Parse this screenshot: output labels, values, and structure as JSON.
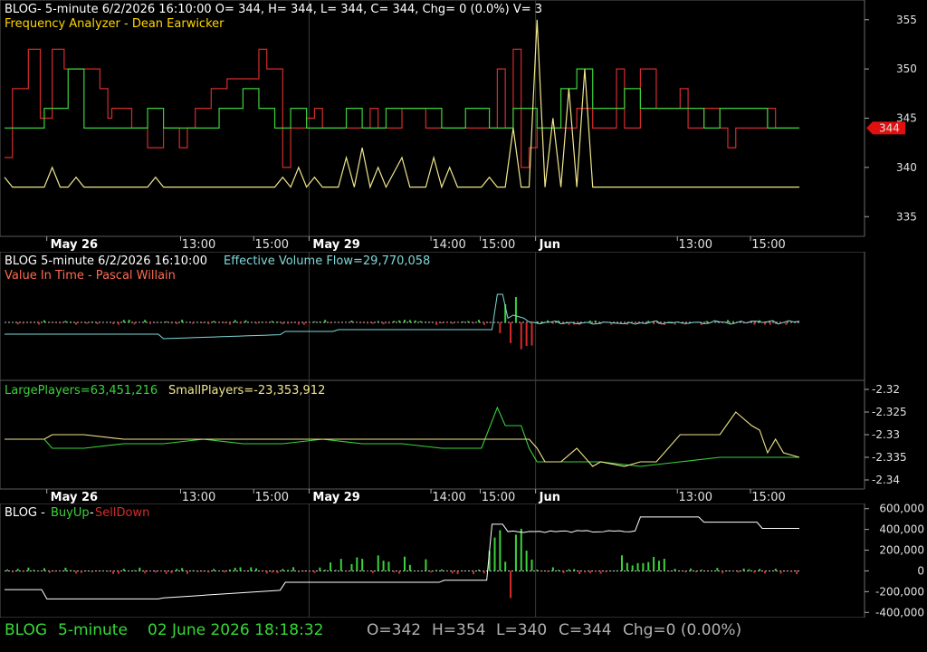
{
  "colors": {
    "red": "#d42c2c",
    "green": "#3bd23b",
    "yellow": "#f0e68c",
    "cyan": "#7fd8d8",
    "orange_text": "#ff5a3c",
    "salmon_text": "#ff6b50",
    "white": "#ffffff",
    "grid": "#3a3a3a",
    "status_green": "#35d935",
    "status_gray": "#b0b0b0"
  },
  "panel1": {
    "header_line1": "BLOG- 5-minute 6/2/2026 16:10:00 O= 344, H= 344, L= 344, C= 344, Chg= 0 (0.0%) V= 3",
    "header_line2": "Frequency Analyzer - Dean Earwicker",
    "price_marker": "344"
  },
  "panel2": {
    "header_a": "BLOG 5-minute  6/2/2026 16:10:00",
    "header_b": "Effective Volume Flow=29,770,058",
    "header_line2": "Value In Time - Pascal Willain"
  },
  "panel3": {
    "header_a": "LargePlayers=63,451,216",
    "header_b": "SmallPlayers=-23,353,912"
  },
  "panel4": {
    "header_a": "BLOG - ",
    "header_b": "BuyUp",
    "header_c": "-",
    "header_d": "SellDown"
  },
  "status": {
    "symbol": "BLOG",
    "interval": "5-minute",
    "datetime": "02 June 2026 18:18:32",
    "open": "O=342",
    "high": "H=354",
    "low": "L=340",
    "close": "C=344",
    "chg": "Chg=0 (0.00%)"
  },
  "x_labels": {
    "dates": [
      {
        "label": "May 26",
        "x": 0.06
      },
      {
        "label": "May 29",
        "x": 0.39
      },
      {
        "label": "Jun",
        "x": 0.675
      }
    ],
    "times": [
      {
        "label": "13:00",
        "x": 0.25
      },
      {
        "label": "15:00",
        "x": 0.342
      },
      {
        "label": "14:00",
        "x": 0.565
      },
      {
        "label": "15:00",
        "x": 0.627
      },
      {
        "label": "13:00",
        "x": 0.875
      },
      {
        "label": "15:00",
        "x": 0.967
      }
    ]
  },
  "chart_data": [
    {
      "type": "line",
      "panel": "price",
      "ylim": [
        333,
        357
      ],
      "yticks": [
        335,
        340,
        345,
        350,
        355
      ],
      "series": [
        {
          "name": "Frequency Analyzer",
          "color": "#d42c2c",
          "style": "step",
          "x": [
            0,
            0.01,
            0.02,
            0.03,
            0.04,
            0.045,
            0.06,
            0.075,
            0.085,
            0.1,
            0.12,
            0.13,
            0.135,
            0.14,
            0.16,
            0.18,
            0.19,
            0.2,
            0.21,
            0.22,
            0.23,
            0.24,
            0.25,
            0.26,
            0.28,
            0.3,
            0.32,
            0.33,
            0.34,
            0.35,
            0.36,
            0.38,
            0.39,
            0.4,
            0.42,
            0.44,
            0.46,
            0.47,
            0.49,
            0.5,
            0.52,
            0.53,
            0.55,
            0.57,
            0.6,
            0.62,
            0.63,
            0.64,
            0.65,
            0.66,
            0.67,
            0.68,
            0.7,
            0.72,
            0.74,
            0.75,
            0.77,
            0.78,
            0.79,
            0.8,
            0.82,
            0.84,
            0.85,
            0.86,
            0.88,
            0.9,
            0.91,
            0.92,
            0.94,
            0.96,
            0.97,
            0.98,
            1.0
          ],
          "values": [
            341,
            348,
            348,
            352,
            352,
            345,
            352,
            350,
            350,
            350,
            348,
            345,
            346,
            346,
            344,
            342,
            342,
            344,
            344,
            342,
            344,
            346,
            346,
            348,
            349,
            349,
            352,
            350,
            350,
            340,
            344,
            345,
            346,
            344,
            344,
            344,
            346,
            344,
            344,
            346,
            346,
            344,
            344,
            344,
            344,
            350,
            344,
            352,
            340,
            342,
            344,
            344,
            344,
            346,
            344,
            344,
            350,
            344,
            344,
            350,
            346,
            346,
            348,
            344,
            346,
            344,
            342,
            344,
            344,
            346,
            344,
            344,
            344
          ]
        },
        {
          "name": "Frequency Analyzer",
          "color": "#3bd23b",
          "style": "step",
          "x": [
            0,
            0.05,
            0.08,
            0.1,
            0.14,
            0.18,
            0.2,
            0.23,
            0.27,
            0.3,
            0.32,
            0.34,
            0.36,
            0.38,
            0.4,
            0.43,
            0.45,
            0.48,
            0.52,
            0.55,
            0.58,
            0.61,
            0.64,
            0.67,
            0.7,
            0.72,
            0.74,
            0.78,
            0.8,
            0.83,
            0.86,
            0.88,
            0.9,
            0.93,
            0.96,
            1.0
          ],
          "values": [
            344,
            346,
            350,
            344,
            344,
            346,
            344,
            344,
            346,
            348,
            346,
            344,
            346,
            344,
            344,
            346,
            344,
            346,
            346,
            344,
            346,
            344,
            346,
            344,
            348,
            350,
            346,
            348,
            346,
            346,
            346,
            344,
            346,
            346,
            344,
            344
          ]
        },
        {
          "name": "Frequency Analyzer",
          "color": "#f0e68c",
          "style": "line",
          "x": [
            0,
            0.01,
            0.02,
            0.05,
            0.06,
            0.07,
            0.08,
            0.09,
            0.1,
            0.12,
            0.14,
            0.16,
            0.18,
            0.19,
            0.2,
            0.22,
            0.25,
            0.28,
            0.3,
            0.32,
            0.34,
            0.35,
            0.36,
            0.37,
            0.38,
            0.39,
            0.4,
            0.41,
            0.42,
            0.43,
            0.44,
            0.45,
            0.46,
            0.47,
            0.48,
            0.5,
            0.51,
            0.52,
            0.53,
            0.54,
            0.55,
            0.56,
            0.57,
            0.6,
            0.61,
            0.62,
            0.63,
            0.64,
            0.65,
            0.66,
            0.67,
            0.68,
            0.69,
            0.7,
            0.71,
            0.72,
            0.73,
            0.74,
            0.75,
            0.8,
            0.85,
            0.9,
            0.95,
            1.0
          ],
          "values": [
            339,
            338,
            338,
            338,
            340,
            338,
            338,
            339,
            338,
            338,
            338,
            338,
            338,
            339,
            338,
            338,
            338,
            338,
            338,
            338,
            338,
            339,
            338,
            340,
            338,
            339,
            338,
            338,
            338,
            341,
            338,
            342,
            338,
            340,
            338,
            341,
            338,
            338,
            338,
            341,
            338,
            340,
            338,
            338,
            339,
            338,
            338,
            344,
            338,
            338,
            355,
            338,
            345,
            338,
            348,
            338,
            350,
            338,
            338,
            338,
            338,
            338,
            338,
            338
          ]
        }
      ]
    },
    {
      "type": "bar",
      "panel": "value_in_time",
      "title": "Effective Volume Flow",
      "series": [
        {
          "name": "Effective Volume Flow",
          "color": "#7fd8d8",
          "style": "line"
        }
      ]
    },
    {
      "type": "line",
      "panel": "players",
      "ylim": [
        -2.342,
        -2.318
      ],
      "yticks": [
        -2.32,
        -2.325,
        -2.33,
        -2.335,
        -2.34
      ],
      "series": [
        {
          "name": "LargePlayers",
          "color": "#3bd23b",
          "x": [
            0,
            0.05,
            0.06,
            0.1,
            0.15,
            0.2,
            0.25,
            0.3,
            0.35,
            0.4,
            0.45,
            0.5,
            0.55,
            0.6,
            0.62,
            0.63,
            0.65,
            0.66,
            0.67,
            0.68,
            0.7,
            0.75,
            0.8,
            0.85,
            0.9,
            0.95,
            1.0
          ],
          "values": [
            -2.331,
            -2.331,
            -2.333,
            -2.333,
            -2.332,
            -2.332,
            -2.331,
            -2.332,
            -2.332,
            -2.331,
            -2.332,
            -2.332,
            -2.333,
            -2.333,
            -2.324,
            -2.328,
            -2.328,
            -2.333,
            -2.336,
            -2.336,
            -2.336,
            -2.336,
            -2.337,
            -2.336,
            -2.335,
            -2.335,
            -2.335
          ]
        },
        {
          "name": "SmallPlayers",
          "color": "#f0e68c",
          "x": [
            0,
            0.05,
            0.06,
            0.1,
            0.15,
            0.2,
            0.25,
            0.3,
            0.35,
            0.4,
            0.45,
            0.5,
            0.55,
            0.6,
            0.62,
            0.64,
            0.66,
            0.67,
            0.68,
            0.7,
            0.72,
            0.74,
            0.75,
            0.78,
            0.8,
            0.82,
            0.85,
            0.9,
            0.92,
            0.94,
            0.95,
            0.96,
            0.97,
            0.98,
            1.0
          ],
          "values": [
            -2.331,
            -2.331,
            -2.33,
            -2.33,
            -2.331,
            -2.331,
            -2.331,
            -2.331,
            -2.331,
            -2.331,
            -2.331,
            -2.331,
            -2.331,
            -2.331,
            -2.331,
            -2.331,
            -2.331,
            -2.333,
            -2.336,
            -2.336,
            -2.333,
            -2.337,
            -2.336,
            -2.337,
            -2.336,
            -2.336,
            -2.33,
            -2.33,
            -2.325,
            -2.328,
            -2.329,
            -2.334,
            -2.331,
            -2.334,
            -2.335
          ]
        }
      ]
    },
    {
      "type": "bar",
      "panel": "buyup_selldown",
      "ylim": [
        -450000,
        650000
      ],
      "yticks": [
        600000,
        400000,
        200000,
        0,
        -200000,
        -400000
      ],
      "ytick_labels": [
        "600,000",
        "400,000",
        "200,000",
        "0",
        "-200,000",
        "-400,000"
      ],
      "series": [
        {
          "name": "BuyUp",
          "color": "#3bd23b"
        },
        {
          "name": "SellDown",
          "color": "#d42c2c"
        },
        {
          "name": "Cumulative",
          "color": "#ffffff",
          "style": "line"
        }
      ]
    }
  ]
}
